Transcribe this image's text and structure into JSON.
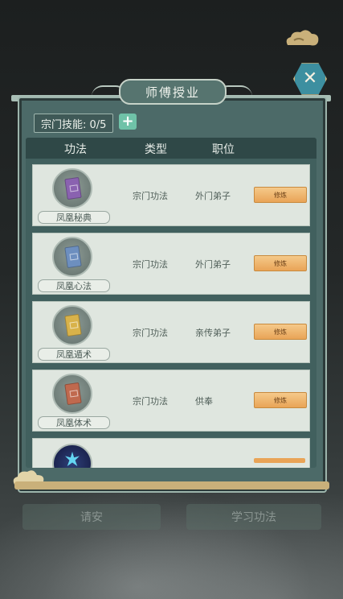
{
  "dialog": {
    "title": "师傅授业",
    "close_icon": "close-icon"
  },
  "skill_count": {
    "label": "宗门技能: 0/5",
    "add_icon": "plus-icon"
  },
  "table": {
    "headers": [
      "功法",
      "类型",
      "职位"
    ],
    "rows": [
      {
        "name": "凤凰秘典",
        "type": "宗门功法",
        "rank": "外门弟子",
        "action": "修炼",
        "icon": "purple-book-icon"
      },
      {
        "name": "凤凰心法",
        "type": "宗门功法",
        "rank": "外门弟子",
        "action": "修炼",
        "icon": "blue-book-icon"
      },
      {
        "name": "凤凰遁术",
        "type": "宗门功法",
        "rank": "亲传弟子",
        "action": "修炼",
        "icon": "gold-book-icon"
      },
      {
        "name": "凤凰体术",
        "type": "宗门功法",
        "rank": "供奉",
        "action": "修炼",
        "icon": "red-book-icon"
      }
    ],
    "partial_row_icon": "crystal-icon"
  },
  "background_buttons": {
    "left": "请安",
    "right": "学习功法"
  },
  "colors": {
    "panel": "#4c6a68",
    "accent_button": "#e9a457",
    "close_button": "#3d8fa0"
  }
}
